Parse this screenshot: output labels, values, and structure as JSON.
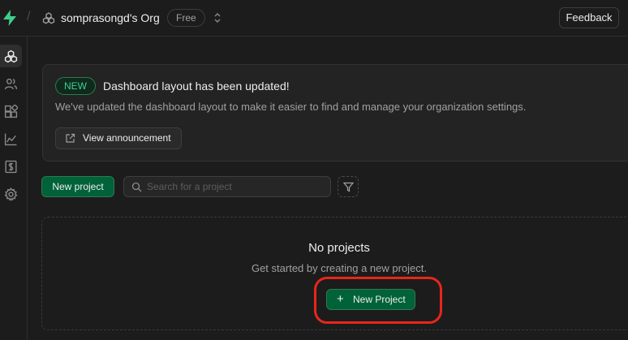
{
  "header": {
    "logo_icon": "supabase-bolt-icon",
    "org_icon": "org-cubes-icon",
    "org_name": "somprasongd's Org",
    "plan_badge": "Free",
    "switcher_icon": "chevron-up-down-icon",
    "feedback_label": "Feedback"
  },
  "sidebar": {
    "items": [
      {
        "icon": "projects-icon",
        "active": true
      },
      {
        "icon": "team-icon",
        "active": false
      },
      {
        "icon": "integrations-icon",
        "active": false
      },
      {
        "icon": "usage-icon",
        "active": false
      },
      {
        "icon": "billing-icon",
        "active": false
      },
      {
        "icon": "settings-icon",
        "active": false
      }
    ]
  },
  "announcement": {
    "badge": "NEW",
    "title": "Dashboard layout has been updated!",
    "description": "We've updated the dashboard layout to make it easier to find and manage your organization settings.",
    "button_label": "View announcement",
    "button_icon": "external-link-icon"
  },
  "toolbar": {
    "new_project_label": "New project",
    "search_placeholder": "Search for a project",
    "search_value": "",
    "filter_icon": "filter-icon"
  },
  "empty_state": {
    "title": "No projects",
    "description": "Get started by creating a new project.",
    "button_label": "New Project",
    "button_icon": "plus-icon"
  },
  "colors": {
    "background": "#1c1c1c",
    "brand_green": "#3ecf8e",
    "button_green": "#006239",
    "highlight_red": "#e8261b"
  }
}
